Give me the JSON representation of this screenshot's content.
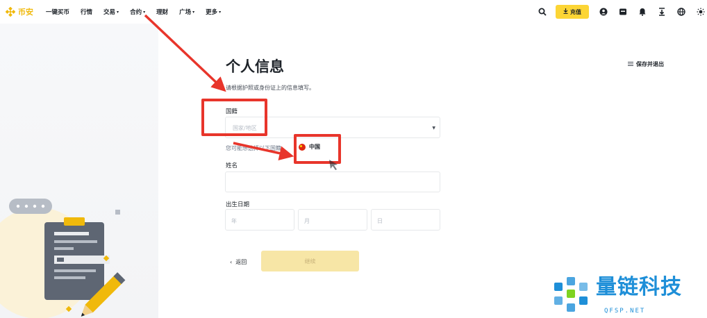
{
  "brand": {
    "name": "币安",
    "color": "#f0b90b"
  },
  "nav": {
    "items": [
      {
        "label": "一键买币",
        "has_menu": false
      },
      {
        "label": "行情",
        "has_menu": false
      },
      {
        "label": "交易",
        "has_menu": true
      },
      {
        "label": "合约",
        "has_menu": true
      },
      {
        "label": "理财",
        "has_menu": false
      },
      {
        "label": "广场",
        "has_menu": true
      },
      {
        "label": "更多",
        "has_menu": true
      }
    ],
    "chevron": "▾",
    "deposit_label": "充值",
    "tools": [
      "search-icon",
      "deposit-button",
      "user-icon",
      "wallet-icon",
      "notification-icon",
      "download-icon",
      "globe-icon",
      "theme-icon"
    ]
  },
  "page": {
    "title": "个人信息",
    "subtitle": "请根据护照或身份证上的信息填写。",
    "save_exit_label": "保存并退出"
  },
  "form": {
    "nationality_label": "国籍",
    "nationality_placeholder": "国家/地区",
    "hint_text": "您可能想选择以下国籍",
    "suggested_country": "中国",
    "name_label": "姓名",
    "dob_label": "出生日期",
    "year_placeholder": "年",
    "month_placeholder": "月",
    "day_placeholder": "日",
    "back_label": "返回",
    "continue_label": "继续"
  },
  "colors": {
    "accent": "#fcd535",
    "annotation_red": "#e8352b",
    "button_disabled": "#f7e6a6"
  },
  "watermark": {
    "name": "量链科技",
    "site": "QFSP.NET"
  }
}
